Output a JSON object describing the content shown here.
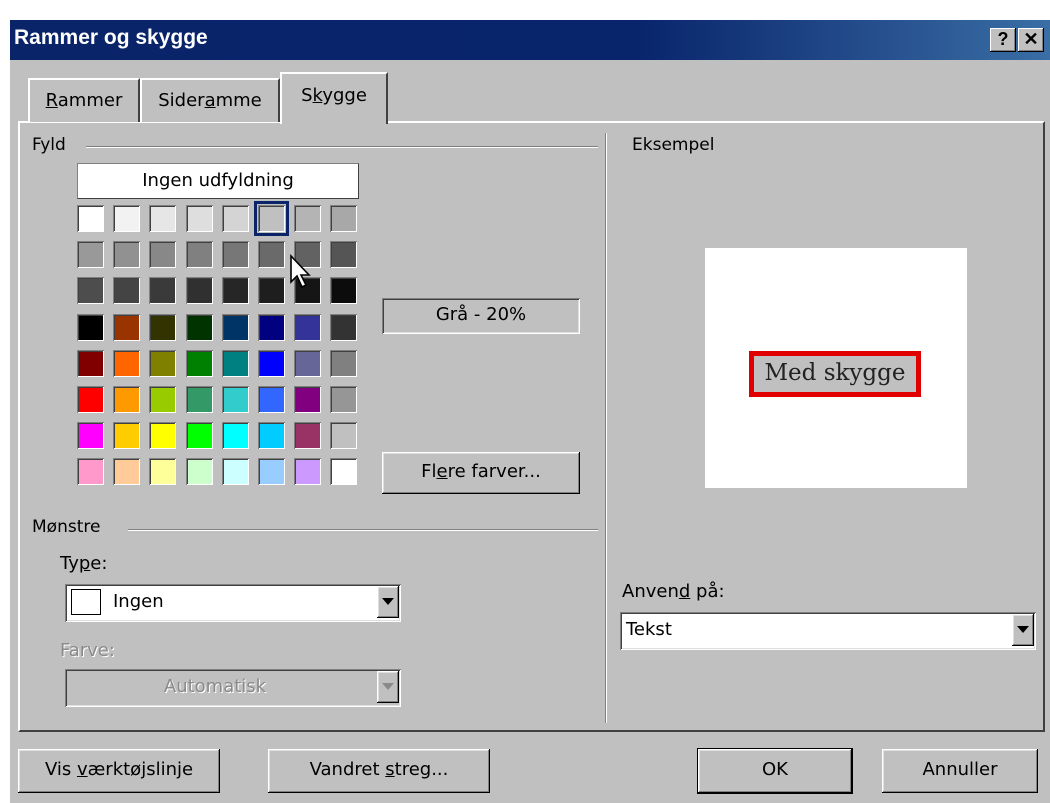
{
  "dialog": {
    "title": "Rammer og skygge",
    "help_glyph": "?",
    "close_glyph": "✕"
  },
  "tabs": [
    {
      "pre": "",
      "ul": "R",
      "post": "ammer"
    },
    {
      "pre": "Sider",
      "ul": "a",
      "post": "mme"
    },
    {
      "pre": "S",
      "ul": "k",
      "post": "ygge"
    }
  ],
  "fill": {
    "group_label": "Fyld",
    "no_fill_label": "Ingen udfyldning",
    "selected_name": "Grå - 20%",
    "more_colors": {
      "pre": "Fl",
      "ul": "e",
      "post": "re farver..."
    },
    "selected_index": 5,
    "palette": [
      [
        "#ffffff",
        "#f2f2f2",
        "#e6e6e6",
        "#dedede",
        "#d4d4d4",
        "#c0c0c0",
        "#b4b4b4",
        "#a8a8a8"
      ],
      [
        "#999999",
        "#919191",
        "#888888",
        "#808080",
        "#777777",
        "#6a6a6a",
        "#626262",
        "#555555"
      ],
      [
        "#4d4d4d",
        "#444444",
        "#3a3a3a",
        "#303030",
        "#262626",
        "#1e1e1e",
        "#151515",
        "#0c0c0c"
      ],
      [
        "#000000",
        "#993300",
        "#333300",
        "#003300",
        "#003366",
        "#000080",
        "#333399",
        "#333333"
      ],
      [
        "#800000",
        "#ff6600",
        "#808000",
        "#008000",
        "#008080",
        "#0000ff",
        "#666699",
        "#808080"
      ],
      [
        "#ff0000",
        "#ff9900",
        "#99cc00",
        "#339966",
        "#33cccc",
        "#3366ff",
        "#800080",
        "#969696"
      ],
      [
        "#ff00ff",
        "#ffcc00",
        "#ffff00",
        "#00ff00",
        "#00ffff",
        "#00ccff",
        "#993366",
        "#c0c0c0"
      ],
      [
        "#ff99cc",
        "#ffcc99",
        "#ffff99",
        "#ccffcc",
        "#ccffff",
        "#99ccff",
        "#cc99ff",
        "#ffffff"
      ]
    ]
  },
  "patterns": {
    "group_label": "Mønstre",
    "type_label": {
      "pre": "Ty",
      "ul": "p",
      "post": "e:"
    },
    "type_value": "Ingen",
    "color_label": "Farve:",
    "color_value": "Automatisk"
  },
  "preview": {
    "group_label": "Eksempel",
    "sample_text": "Med skygge",
    "outline_color": "#e00000"
  },
  "apply_to": {
    "label": {
      "pre": "Anven",
      "ul": "d",
      "post": " på:"
    },
    "value": "Tekst"
  },
  "buttons": {
    "toolbar": {
      "pre": "Vis ",
      "ul": "v",
      "post": "ærktøjslinje"
    },
    "hline": {
      "pre": "Vandret ",
      "ul": "s",
      "post": "treg..."
    },
    "ok": "OK",
    "cancel": "Annuller"
  }
}
